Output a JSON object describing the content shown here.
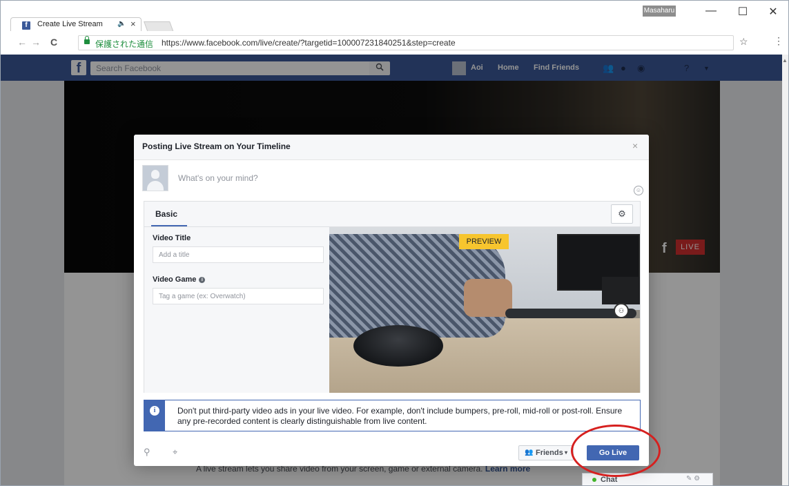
{
  "browser": {
    "tab_title": "Create Live Stream",
    "tab_favicon": "f",
    "tab_audio": "🔈",
    "tab_close": "×",
    "user_badge": "Masaharu",
    "window_controls": {
      "minimize": "—",
      "maximize": "☐",
      "close": "✕"
    },
    "back": "←",
    "forward": "→",
    "reload": "C",
    "secure_label": "保護された通信",
    "url": "https://www.facebook.com/live/create/?targetid=100007231840251&step=create",
    "star": "☆",
    "menu": "⋮"
  },
  "facebook": {
    "logo": "f",
    "search_placeholder": "Search Facebook",
    "search_icon": "🔍",
    "user_name": "Aoi",
    "nav_home": "Home",
    "nav_find_friends": "Find Friends",
    "icons": [
      "friend-requests-icon",
      "messages-icon",
      "notifications-icon",
      "help-icon",
      "dropdown-icon"
    ],
    "cover_live_f": "f",
    "cover_live_label": "LIVE",
    "page_text": "A live stream lets you share video from your screen, game or external camera.",
    "learn_more": "Learn more",
    "chat_label": "Chat",
    "chat_icons": "✎ ⚙"
  },
  "modal": {
    "title": "Posting Live Stream on Your Timeline",
    "close": "×",
    "composer_placeholder": "What's on your mind?",
    "smiley": "☺",
    "tab_basic": "Basic",
    "settings_icon": "⚙",
    "video_title_label": "Video Title",
    "video_title_placeholder": "Add a title",
    "video_game_label": "Video Game",
    "video_game_info": "i",
    "video_game_placeholder": "Tag a game (ex: Overwatch)",
    "preview_badge": "PREVIEW",
    "preview_control": "⚇",
    "notice_icon": "i",
    "notice_text": "Don't put third-party video ads in your live video. For example, don't include bumpers, pre-roll, mid-roll or post-roll. Ensure any pre-recorded content is clearly distinguishable from live content.",
    "tag_icon": "⚲",
    "location_icon": "⌖",
    "friends_icon": "👥",
    "friends_label": "Friends",
    "friends_caret": "▾",
    "go_live": "Go Live"
  },
  "colors": {
    "facebook_blue": "#3b5998",
    "button_blue": "#4267b2",
    "preview_yellow": "#f7c52e",
    "highlight_red": "#d6201f",
    "live_red": "#d03030"
  }
}
